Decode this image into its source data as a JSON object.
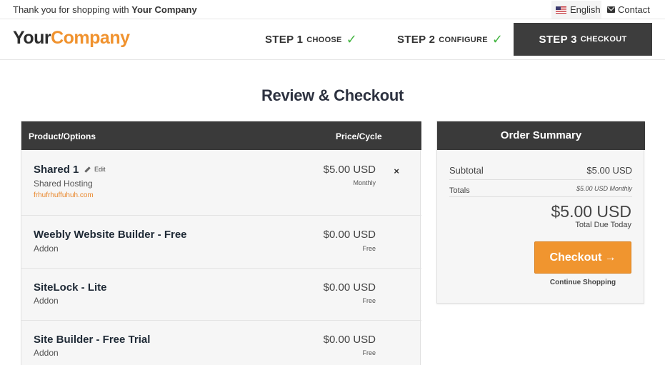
{
  "topbar": {
    "thanks_prefix": "Thank you for shopping with",
    "company": "Your Company",
    "language": "English",
    "contact": "Contact"
  },
  "header": {
    "logo_part1": "Your",
    "logo_part2": "Company",
    "steps": [
      {
        "big": "STEP 1",
        "small": "CHOOSE",
        "done": true
      },
      {
        "big": "STEP 2",
        "small": "CONFIGURE",
        "done": true
      },
      {
        "big": "STEP 3",
        "small": "CHECKOUT",
        "active": true
      }
    ]
  },
  "page": {
    "title": "Review & Checkout"
  },
  "cart": {
    "col_product": "Product/Options",
    "col_price": "Price/Cycle",
    "edit_label": "Edit",
    "remove_label": "×",
    "items": [
      {
        "name": "Shared 1",
        "group": "Shared Hosting",
        "domain": "frhufrhuffuhuh.com",
        "price": "$5.00 USD",
        "cycle": "Monthly"
      },
      {
        "name": "Weebly Website Builder - Free",
        "group": "Addon",
        "price": "$0.00 USD",
        "cycle": "Free"
      },
      {
        "name": "SiteLock - Lite",
        "group": "Addon",
        "price": "$0.00 USD",
        "cycle": "Free"
      },
      {
        "name": "Site Builder - Free Trial",
        "group": "Addon",
        "price": "$0.00 USD",
        "cycle": "Free"
      }
    ]
  },
  "summary": {
    "title": "Order Summary",
    "subtotal_label": "Subtotal",
    "subtotal_value": "$5.00 USD",
    "totals_label": "Totals",
    "totals_value": "$5.00 USD Monthly",
    "total_due": "$5.00 USD",
    "total_due_label": "Total Due Today",
    "checkout_label": "Checkout",
    "checkout_arrow": "→",
    "continue_label": "Continue Shopping"
  },
  "colors": {
    "accent": "#f0952f",
    "dark": "#3a3a3a",
    "check": "#42b540"
  },
  "icons": [
    "us-flag-icon",
    "envelope-icon",
    "check-icon",
    "pencil-icon",
    "close-icon",
    "arrow-right-icon"
  ]
}
